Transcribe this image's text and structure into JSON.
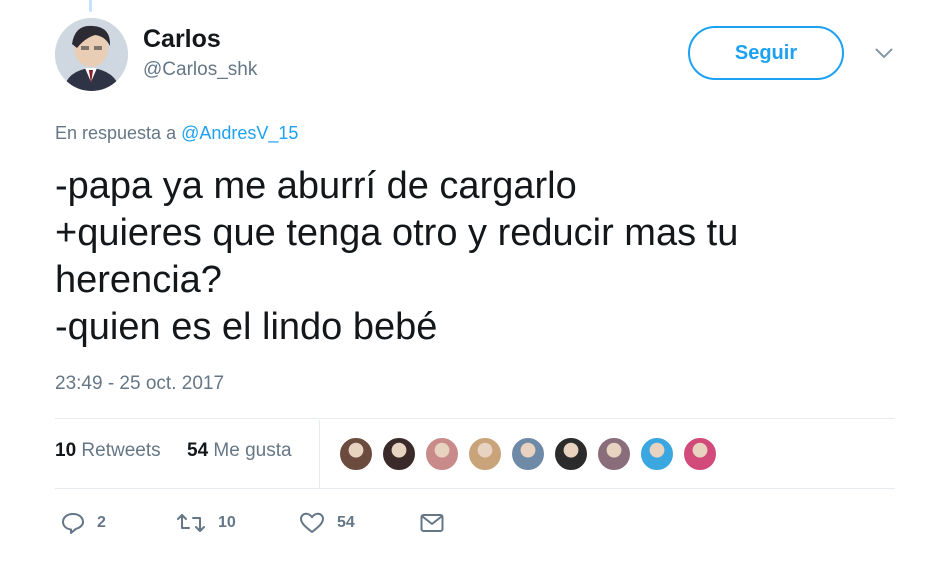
{
  "tweet": {
    "author": {
      "display_name": "Carlos",
      "screen_name": "@Carlos_shk",
      "avatar_icon": "user-avatar"
    },
    "follow_label": "Seguir",
    "menu_icon": "chevron-down-icon",
    "reply_prefix": "En respuesta a",
    "reply_mention": "@AndresV_15",
    "text_lines": [
      "-papa ya me aburrí de cargarlo",
      "+quieres que tenga otro y reducir mas tu",
      "herencia?",
      "-quien es el lindo bebé"
    ],
    "timestamp": "23:49 - 25 oct. 2017",
    "stats": {
      "retweets_count": "10",
      "retweets_label": "Retweets",
      "likes_count": "54",
      "likes_label": "Me gusta"
    },
    "likers": [
      {
        "name": "liker-avatar",
        "color": "#6b4b3e"
      },
      {
        "name": "liker-avatar",
        "color": "#3a2a2a"
      },
      {
        "name": "liker-avatar",
        "color": "#c98a8a"
      },
      {
        "name": "liker-avatar",
        "color": "#c9a37a"
      },
      {
        "name": "liker-avatar",
        "color": "#6f8aa6"
      },
      {
        "name": "liker-avatar",
        "color": "#2b2b2b"
      },
      {
        "name": "liker-avatar",
        "color": "#8a6d7a"
      },
      {
        "name": "liker-avatar",
        "color": "#3aa7e0"
      },
      {
        "name": "liker-avatar",
        "color": "#d14a7a"
      }
    ],
    "actions": {
      "reply_count": "2",
      "retweet_count": "10",
      "like_count": "54"
    },
    "colors": {
      "accent": "#1da1f2",
      "secondary_text": "#657786",
      "primary_text": "#14171a",
      "divider": "#e6ecf0"
    }
  }
}
